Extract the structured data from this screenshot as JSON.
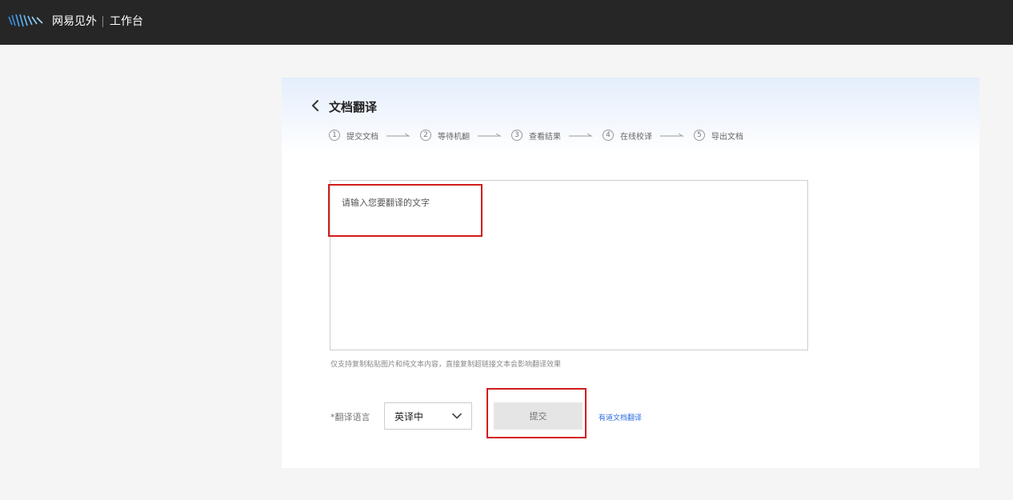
{
  "topbar": {
    "brand": "网易见外",
    "workspace": "工作台",
    "logo_icon": "netease-jianwai-logo-icon"
  },
  "page": {
    "title": "文档翻译",
    "back_icon": "chevron-left-icon"
  },
  "steps": [
    {
      "num": "1",
      "label": "提交文档"
    },
    {
      "num": "2",
      "label": "等待机翻"
    },
    {
      "num": "3",
      "label": "查看结果"
    },
    {
      "num": "4",
      "label": "在线校译"
    },
    {
      "num": "5",
      "label": "导出文档"
    }
  ],
  "editor": {
    "placeholder": "请输入您要翻译的文字",
    "value": "",
    "hint": "仅支持复制粘贴图片和纯文本内容，直接复制超链接文本会影响翻译效果"
  },
  "form": {
    "language_label": "*翻译语言",
    "language_value": "英译中",
    "submit_label": "提交",
    "youdao_link": "有道文档翻译"
  },
  "colors": {
    "topbar": "#262626",
    "highlight": "#d21c1c",
    "link": "#2b6ee0",
    "logo_blue": "#3a8ee6"
  }
}
